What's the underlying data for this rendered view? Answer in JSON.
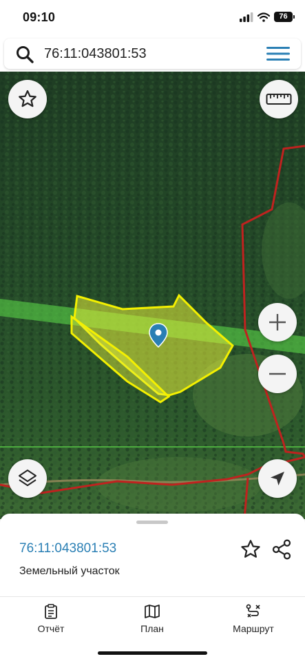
{
  "status_bar": {
    "time": "09:10",
    "battery": "76"
  },
  "search": {
    "value": "76:11:043801:53",
    "placeholder": ""
  },
  "colors": {
    "accent": "#2a7fb4",
    "parcel_fill": "#e6ef3a",
    "parcel_stroke": "#f4f000",
    "boundary": "#c0221f",
    "corridor": "#5fe04a",
    "menu": "#2a7fb4"
  },
  "map": {
    "buttons": [
      "star-icon",
      "ruler-icon",
      "zoom-in-icon",
      "zoom-out-icon",
      "layers-icon",
      "locate-arrow-icon"
    ]
  },
  "sheet": {
    "title": "76:11:043801:53",
    "subtitle": "Земельный участок"
  },
  "tabs": [
    {
      "icon": "report-icon",
      "label": "Отчёт"
    },
    {
      "icon": "map-plan-icon",
      "label": "План"
    },
    {
      "icon": "route-icon",
      "label": "Маршрут"
    }
  ]
}
